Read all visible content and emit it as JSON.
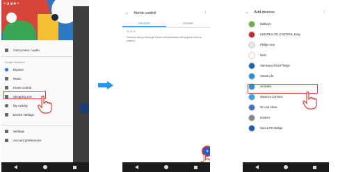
{
  "phone1": {
    "status_left": "⊘ ◪ ◪ ▣ ⊘",
    "status_right": "▼ ◢ ▮ 10:18",
    "item_top": "Cast screen / audio",
    "section_label": "Google Assistant",
    "items": [
      "Explore",
      "Music",
      "Home control",
      "Shopping List",
      "My Activity",
      "Device settings"
    ],
    "bottom_items": [
      "Settings",
      "Account preferences"
    ]
  },
  "phone2": {
    "title": "Home control",
    "more": "⋮",
    "back": "←",
    "tabs": [
      "DEVICES",
      "ROOMS"
    ],
    "dots": "○○○",
    "message": "Devices set up through Home and Assistant will appear here to control.",
    "fab": "+"
  },
  "phone3": {
    "title": "Add devices",
    "back": "←",
    "more": "⋮",
    "devices": [
      {
        "name": "Bullseye",
        "color": "#6fb23e"
      },
      {
        "name": "CENTRALITE CONTROL Easy",
        "color": "#cc2a2a"
      },
      {
        "name": "Philips Hue",
        "color": "#e8e8e8"
      },
      {
        "name": "Nest",
        "color": "#ffffff"
      },
      {
        "name": "Samsung SmartThings",
        "color": "#1c67b3"
      },
      {
        "name": "Smart Life",
        "color": "#2e8fdb"
      },
      {
        "name": "innovelis",
        "color": "#2d8dd7"
      },
      {
        "name": "iDevices Connect",
        "color": "#2fa8e0"
      },
      {
        "name": "ID Link Alexa",
        "color": "#3f74c3"
      },
      {
        "name": "Insteon",
        "color": "#888888"
      },
      {
        "name": "kasa LIFE Bridge",
        "color": "#1d5eaf"
      }
    ]
  },
  "colors": {
    "accent": "#1a73e8",
    "highlight": "#e23b2c",
    "arrow": "#2196f3"
  }
}
